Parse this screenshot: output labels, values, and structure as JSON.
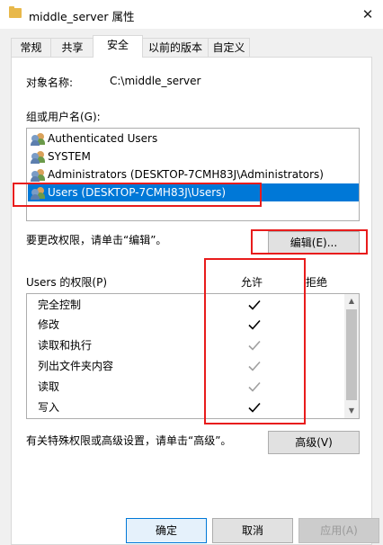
{
  "window": {
    "title": "middle_server 属性",
    "close_symbol": "✕"
  },
  "tabs": [
    {
      "label": "常规",
      "active": false
    },
    {
      "label": "共享",
      "active": false
    },
    {
      "label": "安全",
      "active": true
    },
    {
      "label": "以前的版本",
      "active": false
    },
    {
      "label": "自定义",
      "active": false
    }
  ],
  "security": {
    "object_name_label": "对象名称:",
    "object_name_value": "C:\\middle_server",
    "groups_label": "组或用户名(G):",
    "groups": [
      {
        "name": "Authenticated Users",
        "selected": false
      },
      {
        "name": "SYSTEM",
        "selected": false
      },
      {
        "name": "Administrators (DESKTOP-7CMH83J\\Administrators)",
        "selected": false
      },
      {
        "name": "Users (DESKTOP-7CMH83J\\Users)",
        "selected": true
      }
    ],
    "change_hint": "要更改权限，请单击“编辑”。",
    "edit_button": "编辑(E)...",
    "perm_header": "Users 的权限(P)",
    "allow_header": "允许",
    "deny_header": "拒绝",
    "permissions": [
      {
        "name": "完全控制",
        "allow": true,
        "inherited": false
      },
      {
        "name": "修改",
        "allow": true,
        "inherited": false
      },
      {
        "name": "读取和执行",
        "allow": true,
        "inherited": true
      },
      {
        "name": "列出文件夹内容",
        "allow": true,
        "inherited": true
      },
      {
        "name": "读取",
        "allow": true,
        "inherited": true
      },
      {
        "name": "写入",
        "allow": true,
        "inherited": false
      }
    ],
    "advanced_hint": "有关特殊权限或高级设置，请单击“高级”。",
    "advanced_button": "高级(V)"
  },
  "footer": {
    "ok": "确定",
    "cancel": "取消",
    "apply": "应用(A)"
  },
  "colors": {
    "selection": "#0078d7",
    "annotation": "#e81c1c",
    "check_dark": "#000000",
    "check_gray": "#a0a0a0"
  },
  "icons": {
    "user_group": "users-icon",
    "check": "check-icon",
    "folder": "folder-icon"
  }
}
